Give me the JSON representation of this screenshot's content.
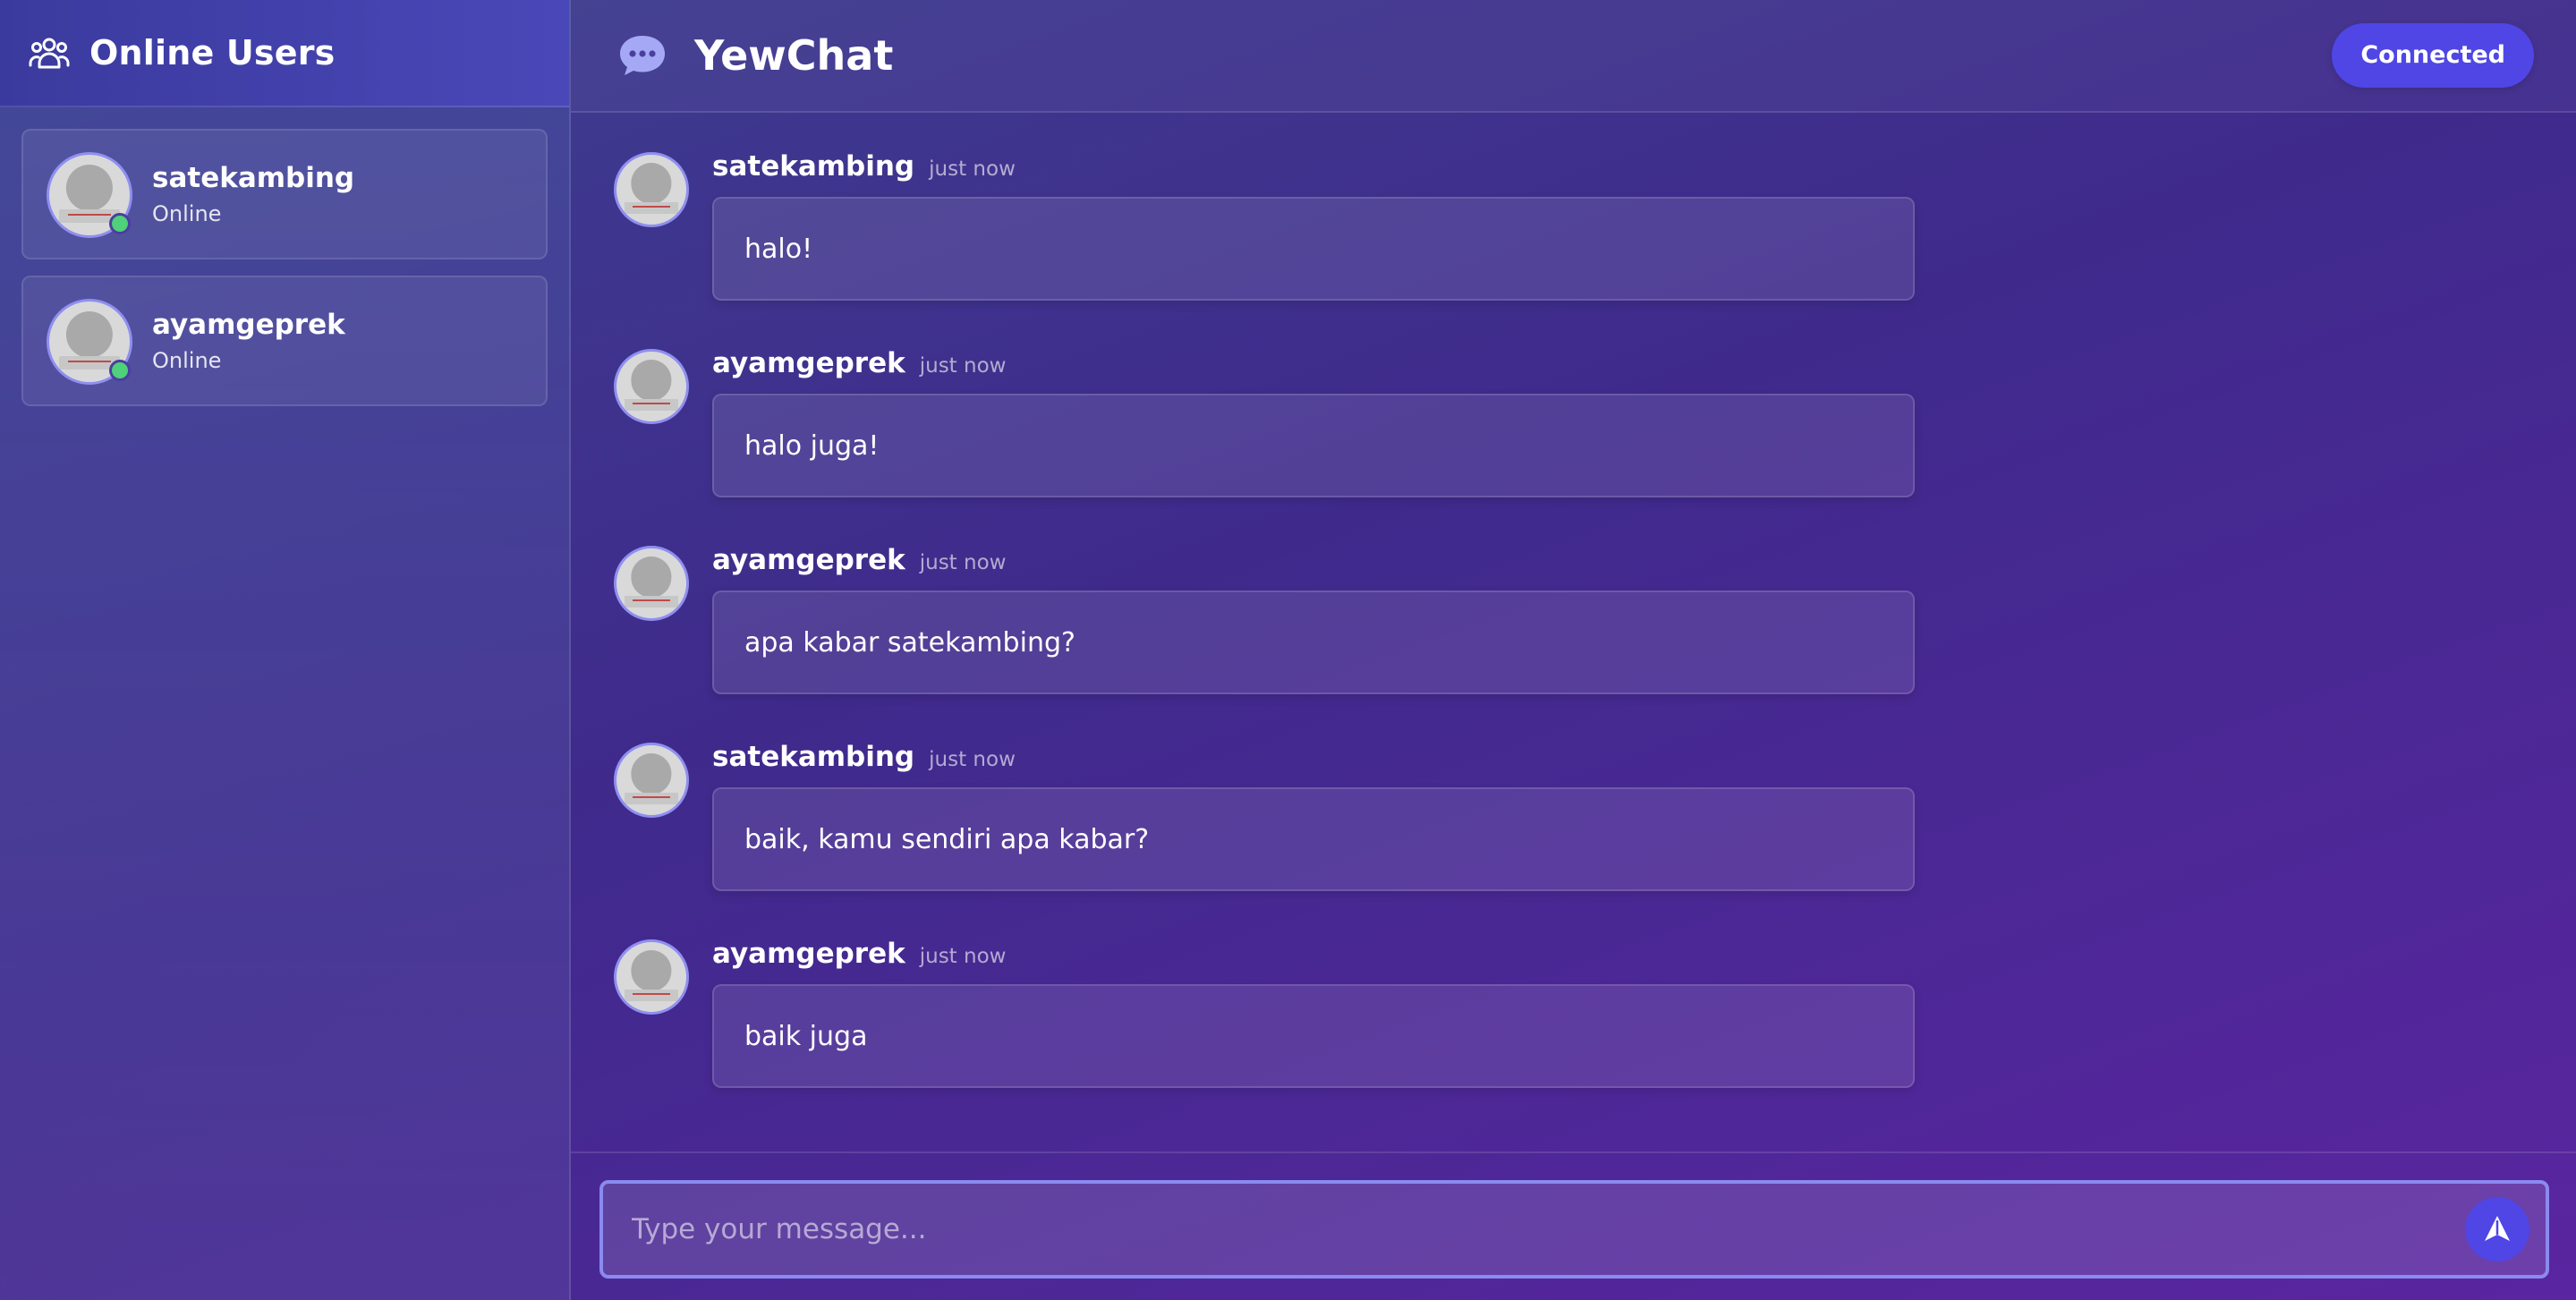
{
  "sidebar": {
    "title": "Online Users",
    "icon": "users-icon",
    "users": [
      {
        "name": "satekambing",
        "status": "Online"
      },
      {
        "name": "ayamgeprek",
        "status": "Online"
      }
    ]
  },
  "header": {
    "title": "YewChat",
    "icon": "chat-bubble-icon",
    "connection_status": "Connected"
  },
  "messages": [
    {
      "author": "satekambing",
      "time": "just now",
      "text": "halo!"
    },
    {
      "author": "ayamgeprek",
      "time": "just now",
      "text": "halo juga!"
    },
    {
      "author": "ayamgeprek",
      "time": "just now",
      "text": "apa kabar satekambing?"
    },
    {
      "author": "satekambing",
      "time": "just now",
      "text": "baik, kamu sendiri apa kabar?"
    },
    {
      "author": "ayamgeprek",
      "time": "just now",
      "text": "baik juga"
    }
  ],
  "composer": {
    "placeholder": "Type your message...",
    "value": "",
    "send_icon": "send-icon"
  },
  "colors": {
    "accent": "#4f46e5",
    "online": "#4fd07a",
    "avatar_border": "#8f8ff0"
  }
}
